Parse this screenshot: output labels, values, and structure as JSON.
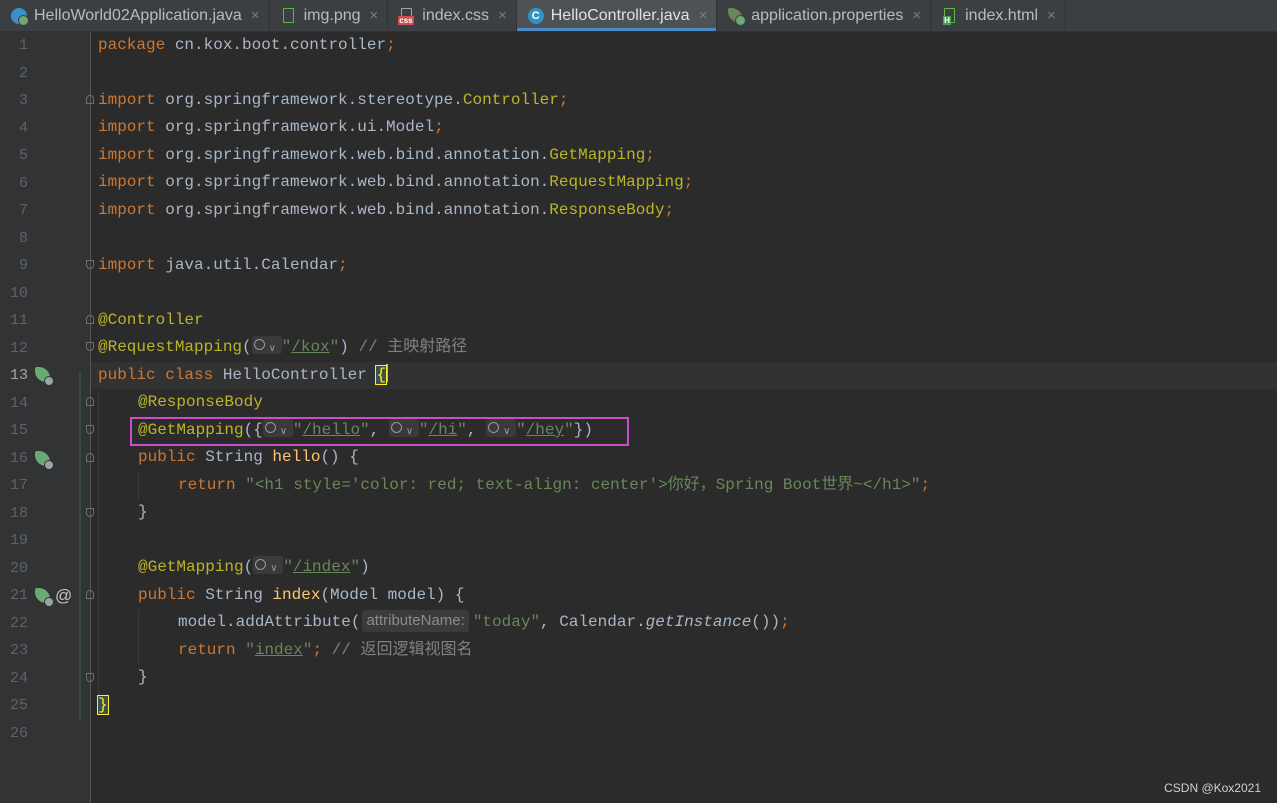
{
  "tabs": [
    {
      "label": "HelloWorld02Application.java",
      "icon": "spring-app-icon",
      "active": false
    },
    {
      "label": "img.png",
      "icon": "image-file-icon",
      "active": false
    },
    {
      "label": "index.css",
      "icon": "css-file-icon",
      "active": false
    },
    {
      "label": "HelloController.java",
      "icon": "java-class-icon",
      "active": true
    },
    {
      "label": "application.properties",
      "icon": "properties-file-icon",
      "active": false
    },
    {
      "label": "index.html",
      "icon": "html-file-icon",
      "active": false
    }
  ],
  "tab_close_glyph": "×",
  "editor": {
    "line_numbers": [
      "1",
      "2",
      "3",
      "4",
      "5",
      "6",
      "7",
      "8",
      "9",
      "10",
      "11",
      "12",
      "13",
      "14",
      "15",
      "16",
      "17",
      "18",
      "19",
      "20",
      "21",
      "22",
      "23",
      "24",
      "25",
      "26"
    ],
    "current_line": "13",
    "code": {
      "l1": {
        "kw": "package",
        "rest": " cn.kox.boot.controller",
        "semi": ";"
      },
      "l3": {
        "kw": "import",
        "pkg": " org.springframework.stereotype.",
        "cls": "Controller",
        "semi": ";"
      },
      "l4": {
        "kw": "import",
        "pkg": " org.springframework.ui.Model",
        "semi": ";"
      },
      "l5": {
        "kw": "import",
        "pkg": " org.springframework.web.bind.annotation.",
        "cls": "GetMapping",
        "semi": ";"
      },
      "l6": {
        "kw": "import",
        "pkg": " org.springframework.web.bind.annotation.",
        "cls": "RequestMapping",
        "semi": ";"
      },
      "l7": {
        "kw": "import",
        "pkg": " org.springframework.web.bind.annotation.",
        "cls": "ResponseBody",
        "semi": ";"
      },
      "l9": {
        "kw": "import",
        "pkg": " java.util.Calendar",
        "semi": ";"
      },
      "l11": {
        "an": "@Controller"
      },
      "l12": {
        "an": "@RequestMapping",
        "open": "(",
        "q1": "\"",
        "url": "/kox",
        "q2": "\"",
        "close": ")",
        "comment": " // 主映射路径"
      },
      "l13": {
        "kw1": "public",
        "kw2": " class",
        "name": " HelloController ",
        "brace": "{"
      },
      "l14": {
        "an": "@ResponseBody"
      },
      "l15": {
        "an": "@GetMapping",
        "open": "({",
        "q": "\"",
        "url1": "/hello",
        "comma1": ", ",
        "url2": "/hi",
        "comma2": ", ",
        "url3": "/hey",
        "close": "})"
      },
      "l16": {
        "kw": "public",
        "type": " String ",
        "fn": "hello",
        "rest": "() {"
      },
      "l17": {
        "kw": "return",
        "str": " \"<h1 style='color: red; text-align: center'>你好，Spring Boot世界~</h1>\"",
        "semi": ";"
      },
      "l18": {
        "text": "}"
      },
      "l20": {
        "an": "@GetMapping",
        "open": "(",
        "q1": "\"",
        "url": "/index",
        "q2": "\"",
        "close": ")"
      },
      "l21": {
        "kw": "public",
        "type": " String ",
        "fn": "index",
        "rest": "(Model model) {"
      },
      "l22": {
        "obj": "model.addAttribute(",
        "hint": "attributeName:",
        "str": "\"today\"",
        "mid": ", Calendar.",
        "it": "getInstance",
        "end": "())",
        "semi": ";"
      },
      "l23": {
        "kw": "return",
        "q1": " \"",
        "url": "index",
        "q2": "\"",
        "semi": ";",
        "comment": " // 返回逻辑视图名"
      },
      "l24": {
        "text": "}"
      },
      "l25": {
        "text": "}"
      }
    }
  },
  "gutter_at_symbol": "@",
  "watermark": "CSDN @Kox2021",
  "colors": {
    "keyword": "#cc7832",
    "annotation": "#bbb529",
    "string": "#6a8759",
    "comment": "#808080",
    "method": "#ffc66d",
    "highlight_box": "#c84fc8",
    "active_tab_underline": "#4a88c7"
  }
}
